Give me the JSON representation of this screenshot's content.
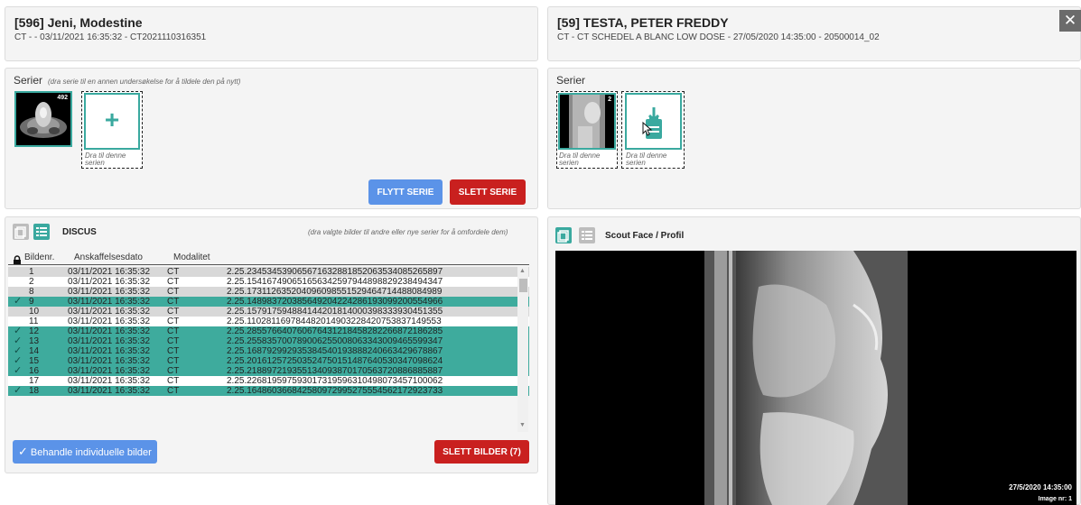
{
  "left_study": {
    "title": "[596] Jeni, Modestine",
    "subtitle": "CT - - 03/11/2021 16:35:32 - CT2021110316351",
    "series_label": "Serier",
    "series_hint": "(dra serie til en annen undersøkelse for å tildele den på nytt)",
    "thumb_count": "492",
    "drop_target_text": "Dra til denne serien",
    "move_button": "FLYTT SERIE",
    "delete_button": "SLETT SERIE"
  },
  "right_study": {
    "title": "[59] TESTA, PETER FREDDY",
    "subtitle": "CT - CT SCHEDEL A BLANC LOW DOSE - 27/05/2020 14:35:00 - 20500014_02",
    "series_label": "Serier",
    "thumb_count": "2",
    "thumb_drop_text": "Dra til denne serien",
    "drop_target_text": "Dra til denne serien",
    "close_icon": "✕"
  },
  "image_list": {
    "series_name": "DISCUS",
    "hint": "(dra valgte bilder til andre eller nye serier for å omfordele dem)",
    "columns": [
      "Bildenr.",
      "Anskaffelsesdato",
      "Modalitet"
    ],
    "rows": [
      {
        "n": "1",
        "date": "03/11/2021 16:35:32",
        "mod": "CT",
        "uid": "2.25.234534539065671632881852063534085265897",
        "state": "gray"
      },
      {
        "n": "2",
        "date": "03/11/2021 16:35:32",
        "mod": "CT",
        "uid": "2.25.154167490651656342597944898829238494347",
        "state": "white"
      },
      {
        "n": "8",
        "date": "03/11/2021 16:35:32",
        "mod": "CT",
        "uid": "2.25.173112635204096098551529464714488084989",
        "state": "gray"
      },
      {
        "n": "9",
        "date": "03/11/2021 16:35:32",
        "mod": "CT",
        "uid": "2.25.148983720385649204224286193099200554966",
        "state": "sel"
      },
      {
        "n": "10",
        "date": "03/11/2021 16:35:32",
        "mod": "CT",
        "uid": "2.25.157917594884144201814000398333930451355",
        "state": "gray"
      },
      {
        "n": "11",
        "date": "03/11/2021 16:35:32",
        "mod": "CT",
        "uid": "2.25.110281169784482014903228420753837149553",
        "state": "white"
      },
      {
        "n": "12",
        "date": "03/11/2021 16:35:32",
        "mod": "CT",
        "uid": "2.25.285576640760676431218458282266872186285",
        "state": "sel"
      },
      {
        "n": "13",
        "date": "03/11/2021 16:35:32",
        "mod": "CT",
        "uid": "2.25.255835700789006255008063343009465599347",
        "state": "sel"
      },
      {
        "n": "14",
        "date": "03/11/2021 16:35:32",
        "mod": "CT",
        "uid": "2.25.168792992935384540193888240663429678867",
        "state": "sel"
      },
      {
        "n": "15",
        "date": "03/11/2021 16:35:32",
        "mod": "CT",
        "uid": "2.25.201612572503524750151487640530347098624",
        "state": "sel"
      },
      {
        "n": "16",
        "date": "03/11/2021 16:35:32",
        "mod": "CT",
        "uid": "2.25.218897219355134093870170563720886885887",
        "state": "sel"
      },
      {
        "n": "17",
        "date": "03/11/2021 16:35:32",
        "mod": "CT",
        "uid": "2.25.226819597593017319596310498073457100062",
        "state": "white"
      },
      {
        "n": "18",
        "date": "03/11/2021 16:35:32",
        "mod": "CT",
        "uid": "2.25.164860366842580972995275554562172923733",
        "state": "sel"
      }
    ],
    "process_button": "Behandle individuelle bilder",
    "delete_button": "SLETT BILDER (7)"
  },
  "viewer": {
    "series_name": "Scout Face / Profil",
    "timestamp": "27/5/2020 14:35:00",
    "image_nr": "Image nr: 1"
  },
  "colors": {
    "accent": "#3eab9d",
    "danger": "#c9201f",
    "primary": "#5b93e8"
  }
}
